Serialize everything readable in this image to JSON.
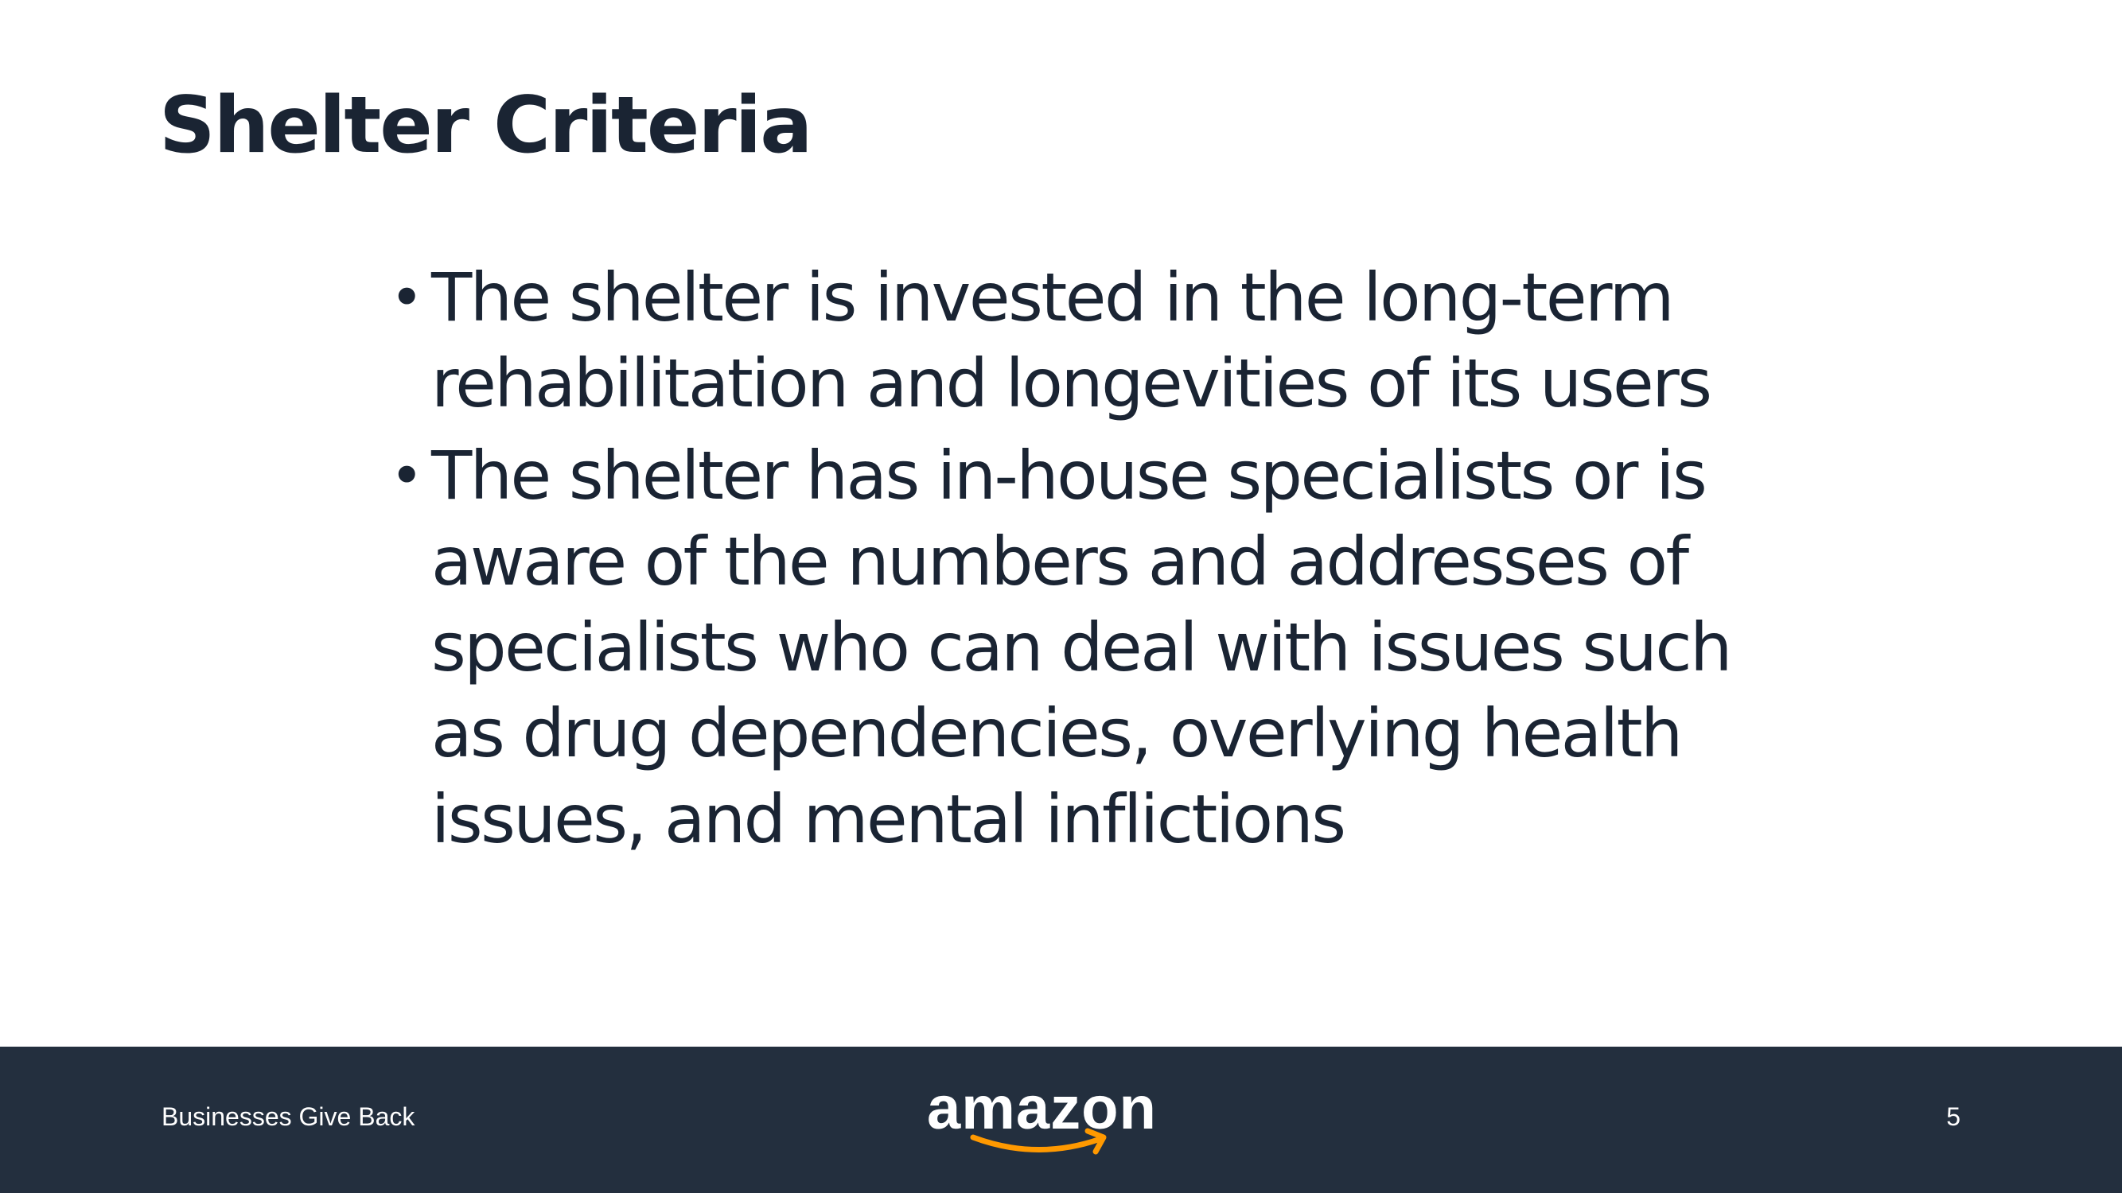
{
  "slide": {
    "title": "Shelter Criteria",
    "bullets": [
      "The shelter is invested in the long-term rehabilitation and longevities of its users",
      "The shelter has in-house specialists or is aware of the numbers and addresses of specialists who can deal with issues such as drug dependencies, overlying health issues, and mental inflictions"
    ],
    "bullet_glyph": "•"
  },
  "footer": {
    "left_text": "Businesses Give Back",
    "logo_text": "amazon",
    "page_number": "5",
    "background_color": "#232f3e",
    "logo_smile_color": "#ff9900"
  }
}
